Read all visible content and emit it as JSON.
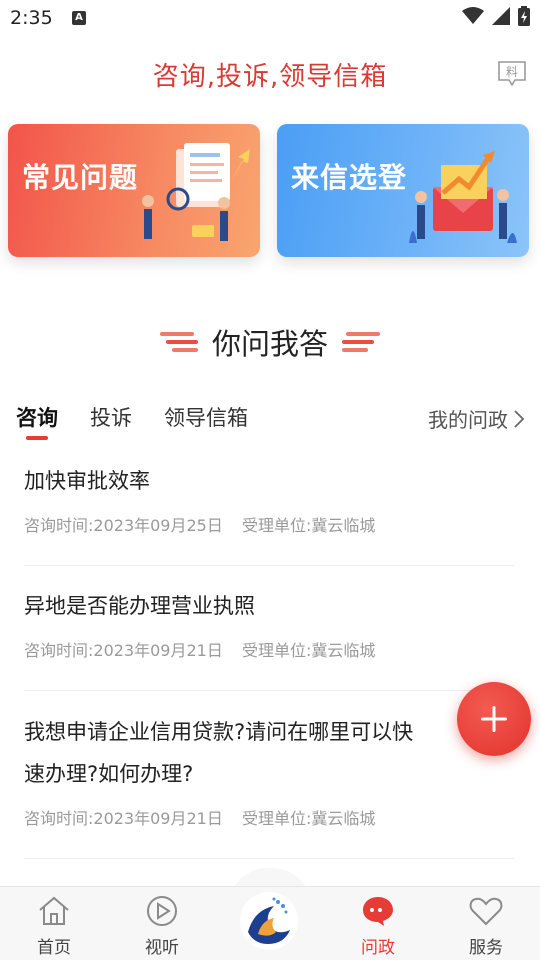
{
  "status_bar": {
    "time": "2:35",
    "indicator": "A"
  },
  "header": {
    "title": "咨询,投诉,领导信箱",
    "report_icon_char": "料"
  },
  "banners": [
    {
      "label": "常见问题",
      "color": "#f2544a"
    },
    {
      "label": "来信选登",
      "color": "#4a9ef5"
    }
  ],
  "section": {
    "title": "你问我答"
  },
  "tabs": [
    {
      "label": "咨询",
      "active": true
    },
    {
      "label": "投诉",
      "active": false
    },
    {
      "label": "领导信箱",
      "active": false
    }
  ],
  "my_politics": "我的问政",
  "list": [
    {
      "title": "加快审批效率",
      "time_label": "咨询时间:",
      "time": "2023年09月25日",
      "unit_label": "受理单位:",
      "unit": "冀云临城"
    },
    {
      "title": "异地是否能办理营业执照",
      "time_label": "咨询时间:",
      "time": "2023年09月21日",
      "unit_label": "受理单位:",
      "unit": "冀云临城"
    },
    {
      "title_line1": "我想申请企业信用贷款?请问在哪里可以快",
      "title_line2": "速办理?如何办理?",
      "time_label": "咨询时间:",
      "time": "2023年09月21日",
      "unit_label": "受理单位:",
      "unit": "冀云临城"
    }
  ],
  "bottom_nav": [
    {
      "label": "首页",
      "icon": "home-icon"
    },
    {
      "label": "视听",
      "icon": "play-icon"
    },
    {
      "label": "问政",
      "icon": "chat-bubble-icon",
      "active": true
    },
    {
      "label": "服务",
      "icon": "heart-icon"
    }
  ],
  "colors": {
    "accent": "#e63c35",
    "title_red": "#d83a35"
  }
}
